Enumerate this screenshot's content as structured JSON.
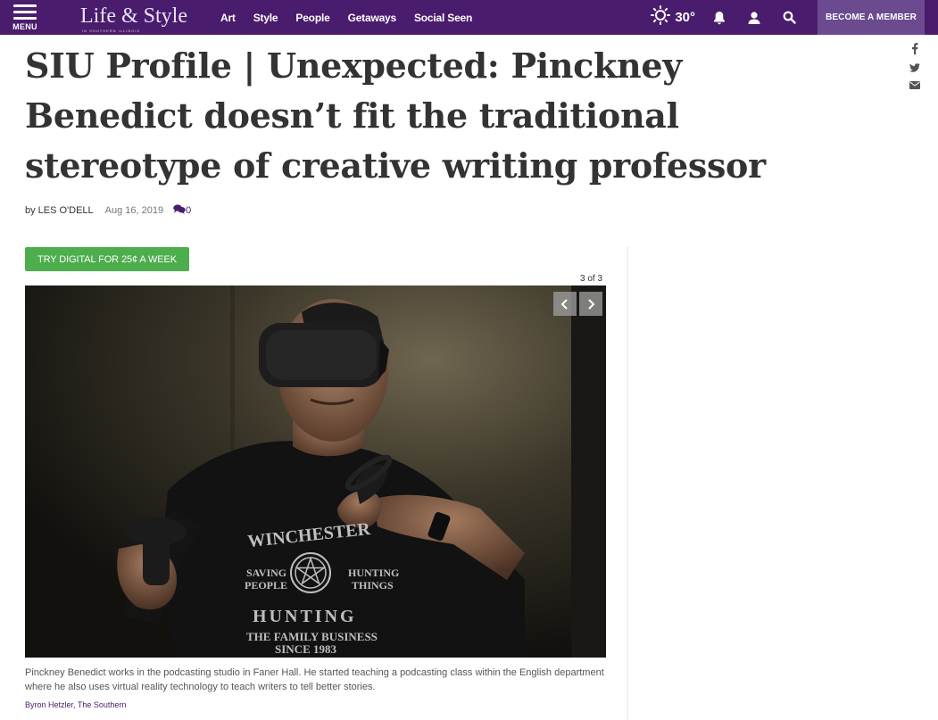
{
  "nav": {
    "menu_label": "MENU",
    "logo_text": "Life & Style",
    "logo_sub": "IN SOUTHERN ILLINOIS",
    "links": [
      "Art",
      "Style",
      "People",
      "Getaways",
      "Social Seen"
    ],
    "weather_temp": "30°",
    "weather_icon": "sun-icon",
    "become_member": "BECOME A MEMBER",
    "brand_color": "#4a1c6d"
  },
  "share": {
    "icons": [
      "facebook-icon",
      "twitter-icon",
      "email-icon"
    ]
  },
  "article": {
    "headline": "SIU Profile | Unexpected: Pinckney Benedict doesn’t fit the traditional stereotype of creative writing professor",
    "by": "by",
    "author": "LES O'DELL",
    "date": "Aug 16, 2019",
    "comment_count": "0"
  },
  "promo": {
    "label": "TRY DIGITAL FOR 25¢ A WEEK",
    "color": "#4cae4c"
  },
  "gallery": {
    "counter": "3 of 3",
    "photo_shirt_text": [
      "WINCHESTER",
      "SAVING",
      "PEOPLE",
      "HUNTING",
      "THINGS",
      "HUNTING",
      "THE FAMILY BUSINESS",
      "SINCE 1983"
    ],
    "caption": "Pinckney Benedict works in the podcasting studio in Faner Hall. He started teaching a podcasting class within the English department where he also uses virtual reality technology to teach writers to tell better stories.",
    "credit": "Byron Hetzler, The Southern"
  }
}
